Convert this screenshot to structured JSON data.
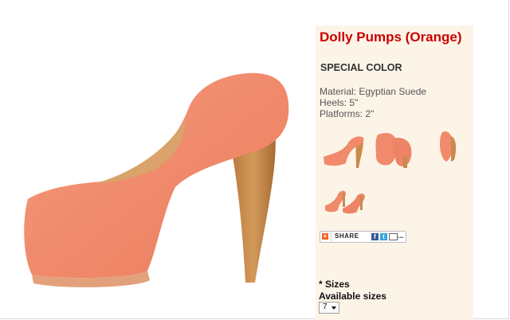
{
  "product": {
    "title": "Dolly Pumps (Orange)",
    "special": "SPECIAL COLOR",
    "specs": [
      "Material: Egyptian Suede",
      "Heels: 5\"",
      "Platforms: 2\""
    ]
  },
  "share": {
    "label": "SHARE",
    "plus": "+",
    "fb": "f",
    "tw": "t",
    "more": "..."
  },
  "sizes": {
    "required_label": "* Sizes",
    "available_label": "Available sizes",
    "selected": "7"
  },
  "colors": {
    "title": "#cc0000",
    "panel_bg": "#fdf4e8",
    "suede": "#f08a6b",
    "wood": "#c98a4b"
  },
  "thumbnails": [
    "side-view",
    "front-view",
    "back-view",
    "pair-view"
  ]
}
